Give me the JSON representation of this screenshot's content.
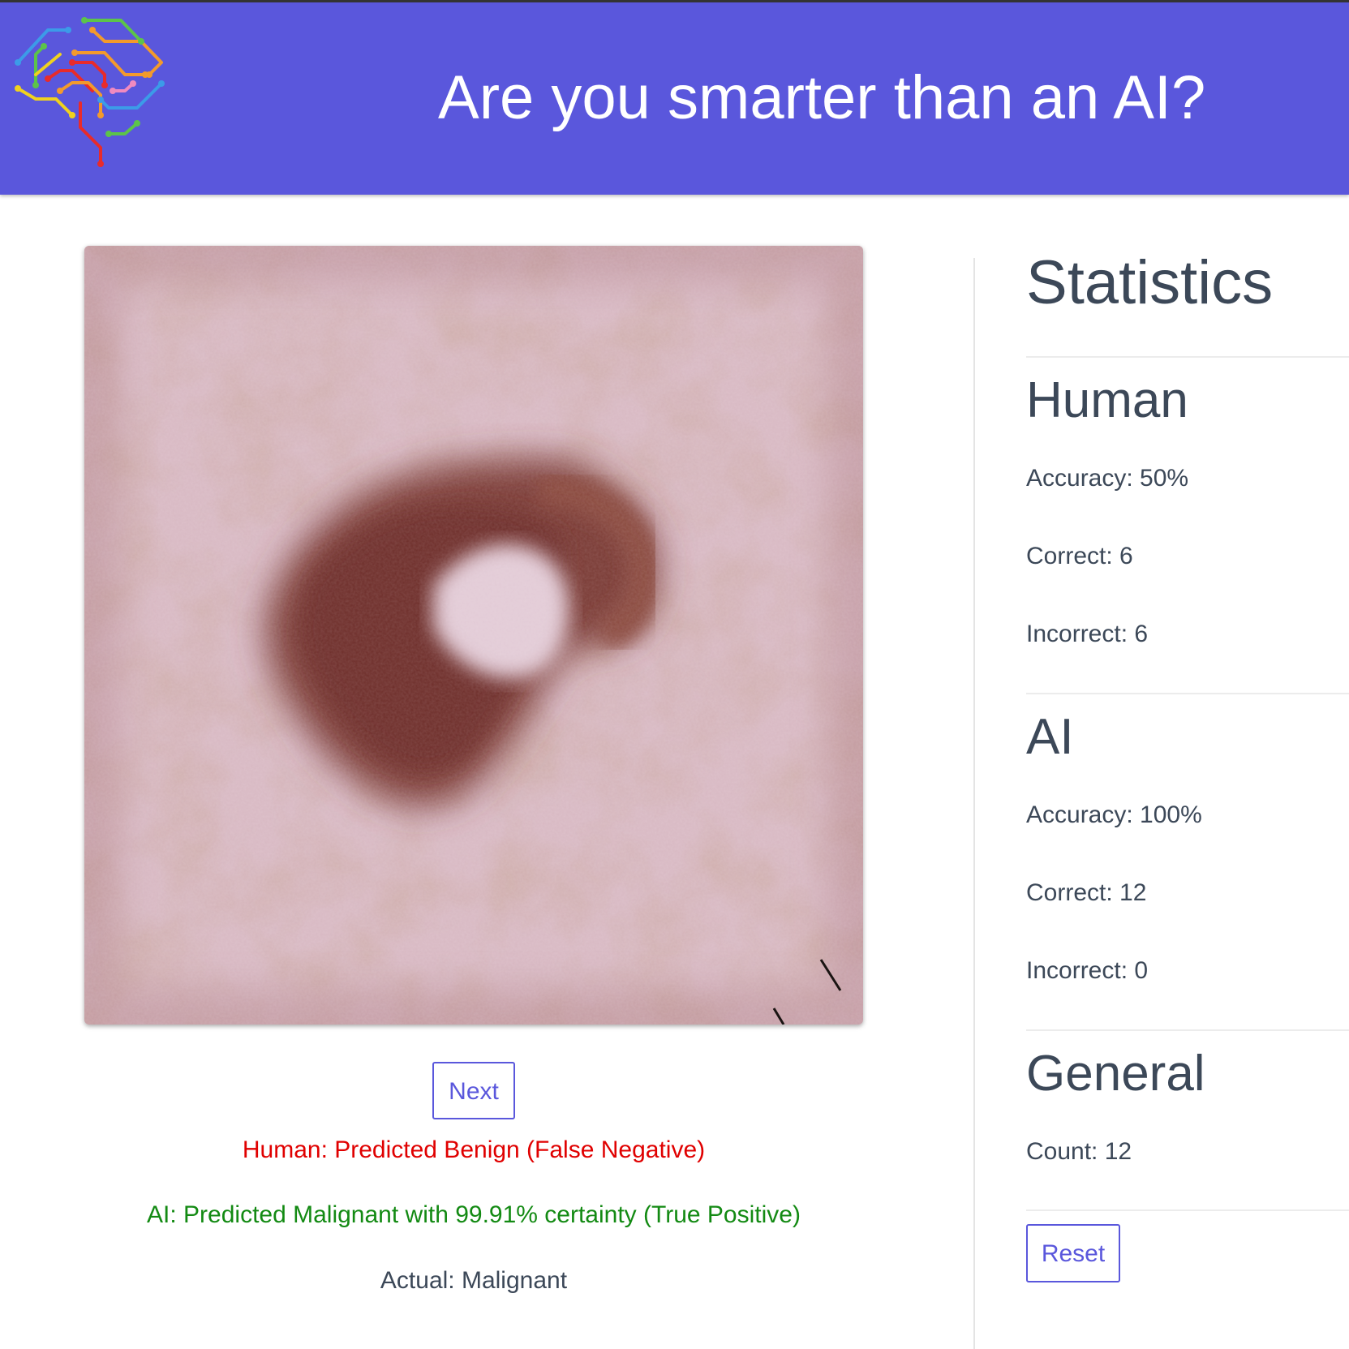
{
  "header": {
    "title": "Are you smarter than an AI?",
    "background_color": "#5a57dc",
    "logo_icon": "circuit-brain-icon"
  },
  "main": {
    "image_icon": "skin-lesion-image",
    "next_label": "Next",
    "human_result": "Human: Predicted Benign (False Negative)",
    "ai_result": "AI: Predicted Malignant with 99.91% certainty (True Positive)",
    "actual_result": "Actual: Malignant",
    "colors": {
      "incorrect": "#e00000",
      "correct": "#138a13",
      "accent": "#5a57dc"
    }
  },
  "stats": {
    "title": "Statistics",
    "human": {
      "heading": "Human",
      "accuracy": "Accuracy: 50%",
      "correct": "Correct: 6",
      "incorrect": "Incorrect: 6"
    },
    "ai": {
      "heading": "AI",
      "accuracy": "Accuracy: 100%",
      "correct": "Correct: 12",
      "incorrect": "Incorrect: 0"
    },
    "general": {
      "heading": "General",
      "count": "Count: 12"
    },
    "reset_label": "Reset"
  }
}
